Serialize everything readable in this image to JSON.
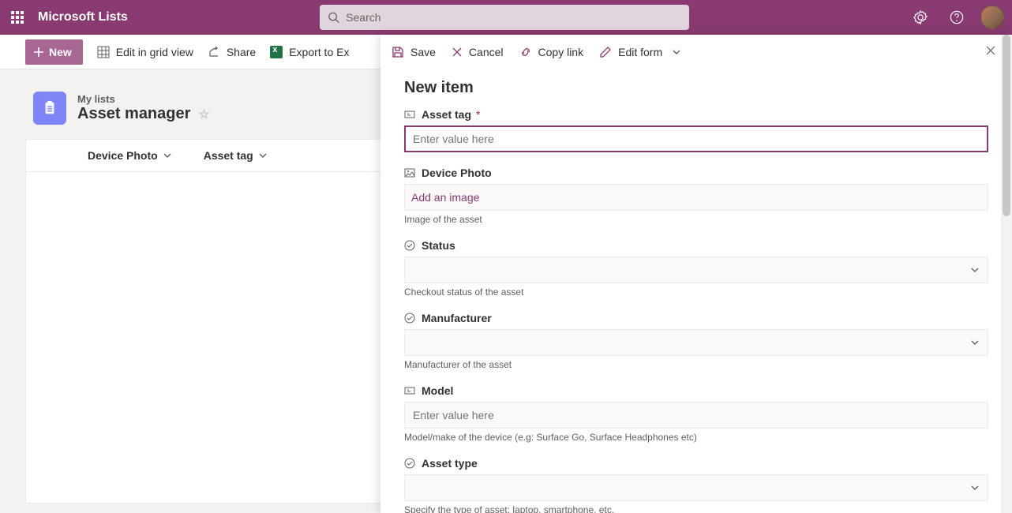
{
  "header": {
    "app_name": "Microsoft Lists",
    "search_placeholder": "Search"
  },
  "commands": {
    "new": "New",
    "edit_grid": "Edit in grid view",
    "share": "Share",
    "export": "Export to Ex"
  },
  "list": {
    "crumb": "My lists",
    "title": "Asset manager",
    "columns": [
      "Device Photo",
      "Asset tag"
    ]
  },
  "panel": {
    "toolbar": {
      "save": "Save",
      "cancel": "Cancel",
      "copy_link": "Copy link",
      "edit_form": "Edit form"
    },
    "title": "New item",
    "fields": {
      "asset_tag": {
        "label": "Asset tag",
        "placeholder": "Enter value here"
      },
      "device_photo": {
        "label": "Device Photo",
        "action": "Add an image",
        "help": "Image of the asset"
      },
      "status": {
        "label": "Status",
        "help": "Checkout status of the asset"
      },
      "manufacturer": {
        "label": "Manufacturer",
        "help": "Manufacturer of the asset"
      },
      "model": {
        "label": "Model",
        "placeholder": "Enter value here",
        "help": "Model/make of the device (e.g: Surface Go, Surface Headphones etc)"
      },
      "asset_type": {
        "label": "Asset type",
        "help": "Specify the type of asset: laptop, smartphone, etc."
      }
    }
  }
}
